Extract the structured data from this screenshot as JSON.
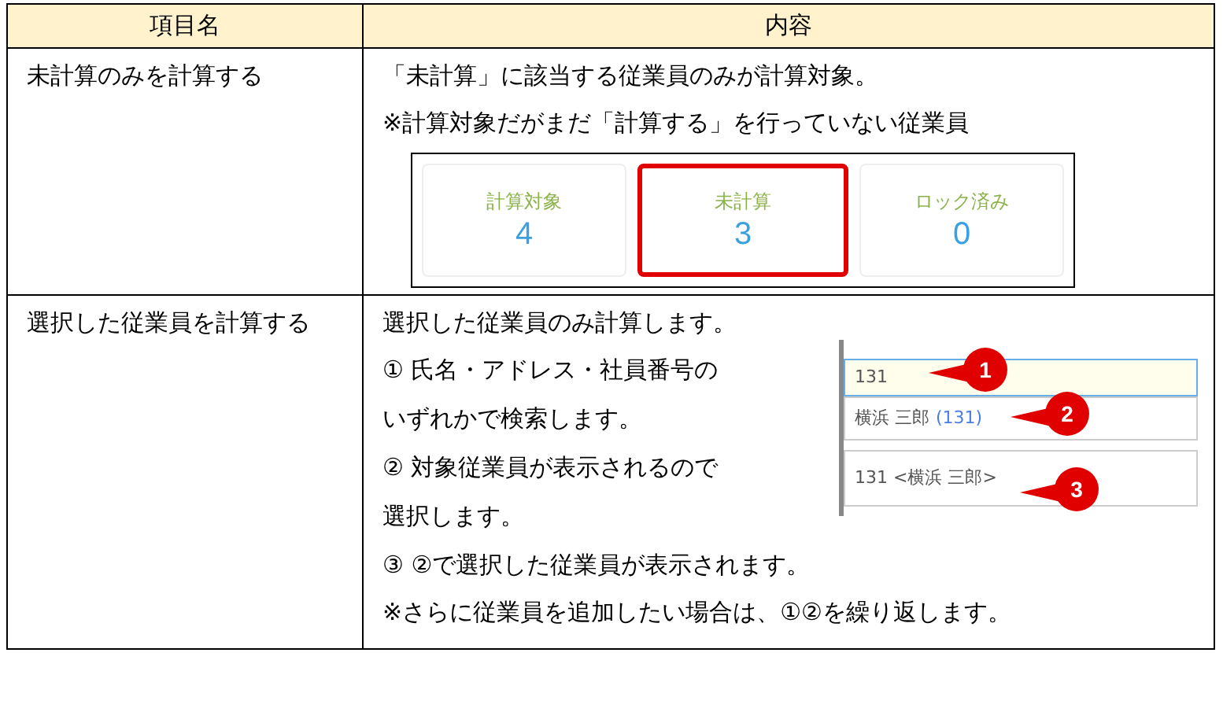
{
  "table": {
    "columns": [
      "項目名",
      "内容"
    ],
    "rows": [
      {
        "kind": "cards",
        "name": "未計算のみを計算する",
        "lines": [
          "「未計算」に該当する従業員のみが計算対象。",
          "※計算対象だがまだ「計算する」を行っていない従業員"
        ],
        "cards": [
          {
            "label": "計算対象",
            "value": "4",
            "selected": false
          },
          {
            "label": "未計算",
            "value": "3",
            "selected": true
          },
          {
            "label": "ロック済み",
            "value": "0",
            "selected": false
          }
        ]
      },
      {
        "kind": "picker",
        "name": "選択した従業員を計算する",
        "lines": [
          "選択した従業員のみ計算します。"
        ],
        "side_lines": [
          "①  氏名・アドレス・社員番号の",
          "いずれかで検索します。",
          "②  対象従業員が表示されるので",
          "選択します。"
        ],
        "after_lines": [
          "③  ②で選択した従業員が表示されます。",
          "※さらに従業員を追加したい場合は、①②を繰り返します。"
        ],
        "picker": {
          "search_value": "131",
          "option_name": "横浜 三郎",
          "option_id": "(131)",
          "selection": "131 <横浜 三郎>",
          "callouts": [
            "1",
            "2",
            "3"
          ]
        }
      }
    ]
  }
}
